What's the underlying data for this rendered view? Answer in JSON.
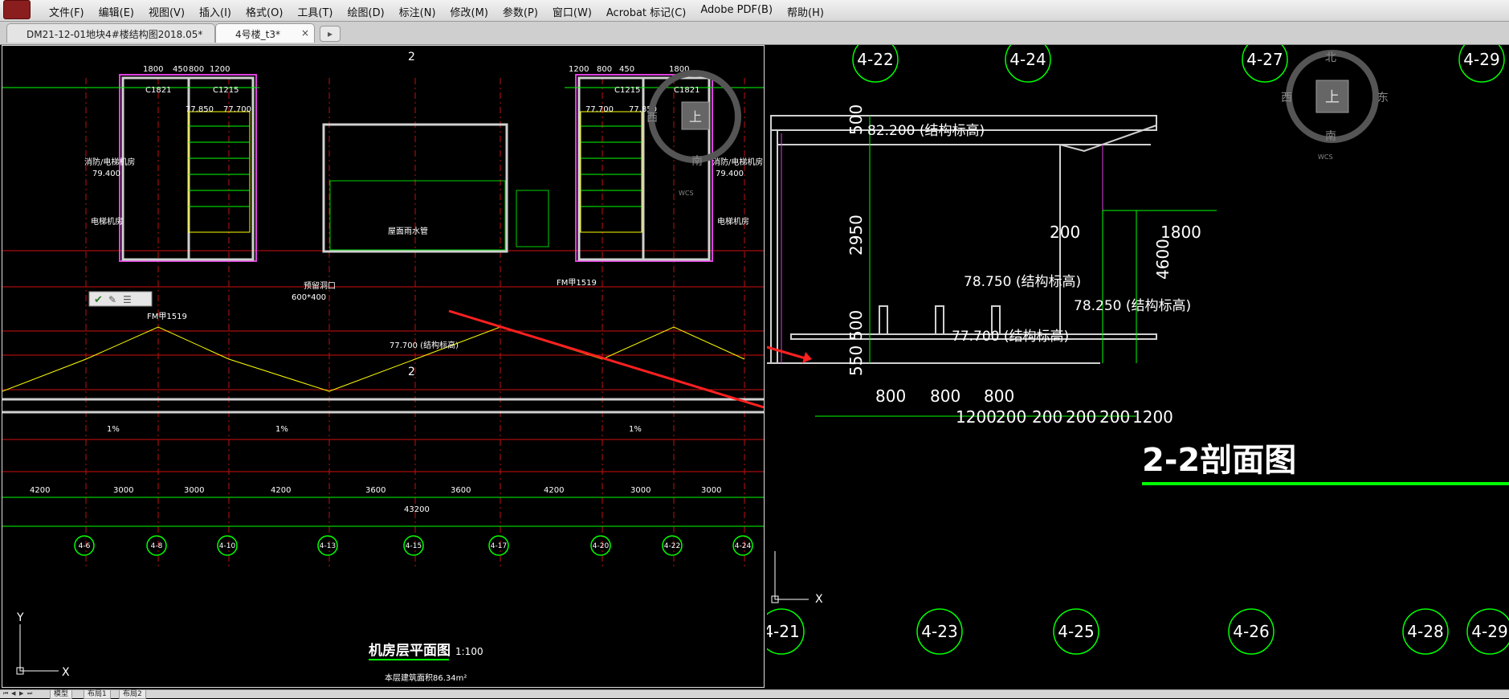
{
  "menu": [
    "文件(F)",
    "编辑(E)",
    "视图(V)",
    "插入(I)",
    "格式(O)",
    "工具(T)",
    "绘图(D)",
    "标注(N)",
    "修改(M)",
    "参数(P)",
    "窗口(W)",
    "Acrobat 标记(C)",
    "Adobe PDF(B)",
    "帮助(H)"
  ],
  "tabs": [
    {
      "label": "DM21-12-01地块4#楼结构图2018.05*",
      "active": false
    },
    {
      "label": "4号楼_t3*",
      "active": true
    }
  ],
  "tab_close_glyph": "×",
  "left": {
    "dims_top_left": [
      "1800",
      "450",
      "800",
      "1200"
    ],
    "dims_top_right": [
      "1200",
      "800",
      "450",
      "1800"
    ],
    "grid_axes": [
      "4-6",
      "4-8",
      "4-10",
      "4-13",
      "4-15",
      "4-17",
      "4-20",
      "4-22",
      "4-24"
    ],
    "bay_dims": [
      "4200",
      "3000",
      "3000",
      "4200",
      "3600",
      "3600",
      "4200",
      "3000",
      "3000"
    ],
    "overall_dim": "43200",
    "section_mark": "2",
    "labels": {
      "window_c1821": "C1821",
      "window_c1215": "C1215",
      "elev_77700": "77.700",
      "elev_77850": "77.850",
      "elev_79400": "79.400",
      "mech_room": "消防/电梯机房",
      "elevator_room": "电梯机房",
      "hole": "预留洞口",
      "size_600x400": "600*400",
      "fire_door": "FM甲1519",
      "roof_note": "屋面雨水管",
      "elev_tag": "77.700 (结构标高)",
      "area_note": "本层建筑面积86.34m²",
      "slope_1": "1%"
    },
    "title": "机房层平面图",
    "scale": "1:100"
  },
  "right": {
    "grid_top": [
      "4-22",
      "4-24",
      "4-27",
      "4-29"
    ],
    "grid_bottom": [
      "4-21",
      "4-23",
      "4-25",
      "4-26",
      "4-28",
      "4-29"
    ],
    "elevations": [
      "82.200 (结构标高)",
      "78.750 (结构标高)",
      "78.250 (结构标高)",
      "77.700 (结构标高)"
    ],
    "vertical_dims": [
      "500",
      "2950",
      "500",
      "550",
      "4600"
    ],
    "dims_200_1800": [
      "200",
      "1800"
    ],
    "dims_800": [
      "800",
      "800",
      "800"
    ],
    "dims_bottom": [
      "1200",
      "200",
      "200",
      "200",
      "200",
      "1200"
    ],
    "section_title": "2-2剖面图"
  },
  "viewcube": {
    "north": "北",
    "south": "南",
    "east": "东",
    "west": "西",
    "face": "上",
    "wcs": "WCS"
  },
  "ucs": {
    "x": "X",
    "y": "Y"
  },
  "layout_tabs": [
    "模型",
    "布局1",
    "布局2"
  ]
}
